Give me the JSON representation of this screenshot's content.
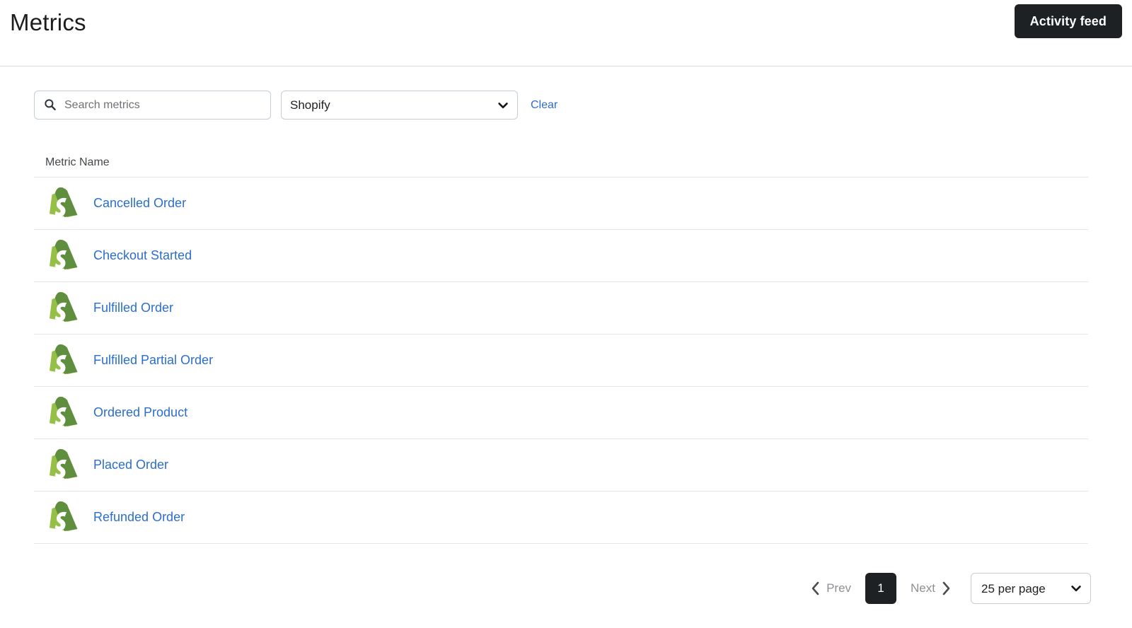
{
  "header": {
    "title": "Metrics",
    "activity_feed_label": "Activity feed"
  },
  "filters": {
    "search": {
      "placeholder": "Search metrics",
      "value": "",
      "icon": "search-icon"
    },
    "integration_select": {
      "value": "Shopify",
      "options": [
        "Shopify"
      ],
      "icon": "chevron-down-icon"
    },
    "clear_label": "Clear"
  },
  "table": {
    "columns": [
      "Metric Name"
    ],
    "rows": [
      {
        "icon": "shopify-icon",
        "name": "Cancelled Order"
      },
      {
        "icon": "shopify-icon",
        "name": "Checkout Started"
      },
      {
        "icon": "shopify-icon",
        "name": "Fulfilled Order"
      },
      {
        "icon": "shopify-icon",
        "name": "Fulfilled Partial Order"
      },
      {
        "icon": "shopify-icon",
        "name": "Ordered Product"
      },
      {
        "icon": "shopify-icon",
        "name": "Placed Order"
      },
      {
        "icon": "shopify-icon",
        "name": "Refunded Order"
      }
    ]
  },
  "pagination": {
    "prev_label": "Prev",
    "next_label": "Next",
    "current_page": "1",
    "per_page": {
      "value": "25 per page",
      "options": [
        "25 per page"
      ],
      "icon": "chevron-down-icon"
    }
  },
  "colors": {
    "link": "#2c6ecb",
    "dark_button": "#1e2124",
    "border": "#c4cdd5",
    "divider": "#e3e5e7",
    "shopify_green_light": "#95bf47",
    "shopify_green_dark": "#5e8e3e",
    "muted_text": "#8c9196"
  }
}
